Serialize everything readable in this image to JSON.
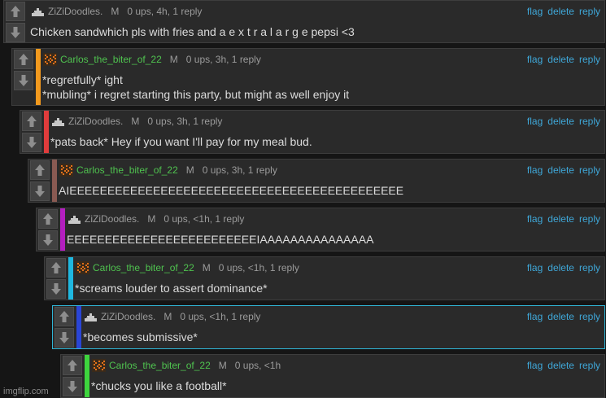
{
  "actions": {
    "flag": "flag",
    "delete": "delete",
    "reply": "reply"
  },
  "icons": {
    "upvote": "up-arrow-icon",
    "downvote": "down-arrow-icon"
  },
  "comments": [
    {
      "user": "ZiZiDoodles.",
      "badge": "M",
      "stats": "0 ups, 4h, 1 reply",
      "lines": [
        "Chicken sandwhich pls with fries and a e x t r a l a r g e pepsi <3"
      ],
      "user_color": "#9b9b9b",
      "stripe_color": ""
    },
    {
      "user": "Carlos_the_biter_of_22",
      "badge": "M",
      "stats": "0 ups, 3h, 1 reply",
      "lines": [
        "*regretfully* ight",
        "*mubling* i regret starting this party, but might as well enjoy it"
      ],
      "user_color": "#4fc24f",
      "stripe_color": "#f39a1e"
    },
    {
      "user": "ZiZiDoodles.",
      "badge": "M",
      "stats": "0 ups, 3h, 1 reply",
      "lines": [
        "*pats back* Hey if you want I'll pay for my meal bud."
      ],
      "user_color": "#9b9b9b",
      "stripe_color": "#e03c3c"
    },
    {
      "user": "Carlos_the_biter_of_22",
      "badge": "M",
      "stats": "0 ups, 3h, 1 reply",
      "lines": [
        "AIEEEEEEEEEEEEEEEEEEEEEEEEEEEEEEEEEEEEEEEEEEEE"
      ],
      "user_color": "#4fc24f",
      "stripe_color": "#8a5a52"
    },
    {
      "user": "ZiZiDoodles.",
      "badge": "M",
      "stats": "0 ups, <1h, 1 reply",
      "lines": [
        "EEEEEEEEEEEEEEEEEEEEEEEEEIAAAAAAAAAAAAAAA"
      ],
      "user_color": "#9b9b9b",
      "stripe_color": "#b31fbf"
    },
    {
      "user": "Carlos_the_biter_of_22",
      "badge": "M",
      "stats": "0 ups, <1h, 1 reply",
      "lines": [
        "*screams louder to assert dominance*"
      ],
      "user_color": "#4fc24f",
      "stripe_color": "#1fb8e0"
    },
    {
      "user": "ZiZiDoodles.",
      "badge": "M",
      "stats": "0 ups, <1h, 1 reply",
      "lines": [
        "*becomes submissive*"
      ],
      "user_color": "#9b9b9b",
      "stripe_color": "#2a45d6"
    },
    {
      "user": "Carlos_the_biter_of_22",
      "badge": "M",
      "stats": "0 ups, <1h",
      "lines": [
        "*chucks you like a football*"
      ],
      "user_color": "#4fc24f",
      "stripe_color": "#3dd43d"
    }
  ],
  "watermark": "imgflip.com"
}
